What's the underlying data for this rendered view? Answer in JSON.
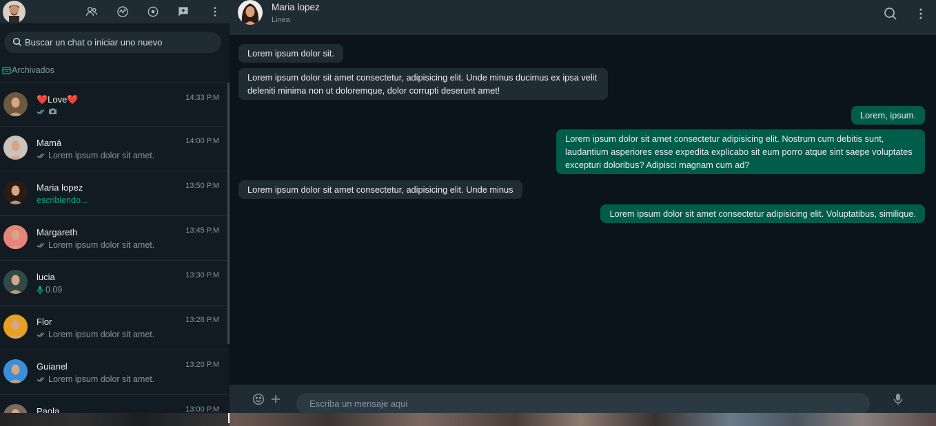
{
  "sidebar": {
    "icons": [
      "community-icon",
      "status-icon",
      "channels-icon",
      "new-chat-icon",
      "menu-dots-icon"
    ],
    "search": {
      "placeholder": "Buscar un chat o iniciar uno nuevo"
    },
    "archived_label": "Archivados",
    "chats": [
      {
        "name": "❤️Love❤️",
        "time": "14:33 P.M",
        "preview": "",
        "preview_type": "photo",
        "avatar_color": "#6b5a3e"
      },
      {
        "name": "Mamá",
        "time": "14:00 P.M",
        "preview": "Lorem ipsum dolor sit amet.",
        "preview_type": "read",
        "avatar_color": "#c9c4bc"
      },
      {
        "name": "Maria lopez",
        "time": "13:50 P.M",
        "preview": "escribiendo...",
        "preview_type": "typing",
        "avatar_color": "#2b1b14"
      },
      {
        "name": "Margareth",
        "time": "13:45 P.M",
        "preview": "Lorem ipsum dolor sit amet.",
        "preview_type": "read",
        "avatar_color": "#e8837a"
      },
      {
        "name": "lucia",
        "time": "13:30 P.M",
        "preview": "0.09",
        "preview_type": "voice",
        "avatar_color": "#2f4a48"
      },
      {
        "name": "Flor",
        "time": "13:28 P.M",
        "preview": "Lorem ipsum dolor sit amet.",
        "preview_type": "read",
        "avatar_color": "#e8a020"
      },
      {
        "name": "Guianel",
        "time": "13:20 P.M",
        "preview": "Lorem ipsum dolor sit amet.",
        "preview_type": "read",
        "avatar_color": "#3a8fd8"
      },
      {
        "name": "Paola",
        "time": "13:00 P.M",
        "preview": "",
        "preview_type": "none",
        "avatar_color": "#7a6a60"
      }
    ]
  },
  "conversation": {
    "contact_name": "Maria lopez",
    "contact_status": "Linea",
    "messages": [
      {
        "dir": "in",
        "text": "Lorem ipsum dolor sit."
      },
      {
        "dir": "in",
        "text": "Lorem ipsum dolor sit amet consectetur, adipisicing elit. Unde minus ducimus ex ipsa velit deleniti minima non ut doloremque, dolor corrupti deserunt amet!"
      },
      {
        "dir": "out",
        "text": "Lorem, ipsum."
      },
      {
        "dir": "out",
        "text": "Lorem ipsum dolor sit amet consectetur adipisicing elit. Nostrum cum debitis sunt, laudantium asperiores esse expedita explicabo sit eum porro atque sint saepe voluptates excepturi doloribus? Adipisci magnam cum ad?"
      },
      {
        "dir": "in",
        "text": "Lorem ipsum dolor sit amet consectetur, adipisicing elit. Unde minus"
      },
      {
        "dir": "out",
        "text": "Lorem ipsum dolor sit amet consectetur adipisicing elit. Voluptatibus, similique."
      }
    ],
    "composer": {
      "placeholder": "Escriba un mensaje aqui"
    }
  },
  "colors": {
    "panel": "#202c33",
    "background": "#0b141a",
    "incoming_bubble": "#202c33",
    "outgoing_bubble": "#005c4b",
    "accent": "#00a884"
  }
}
